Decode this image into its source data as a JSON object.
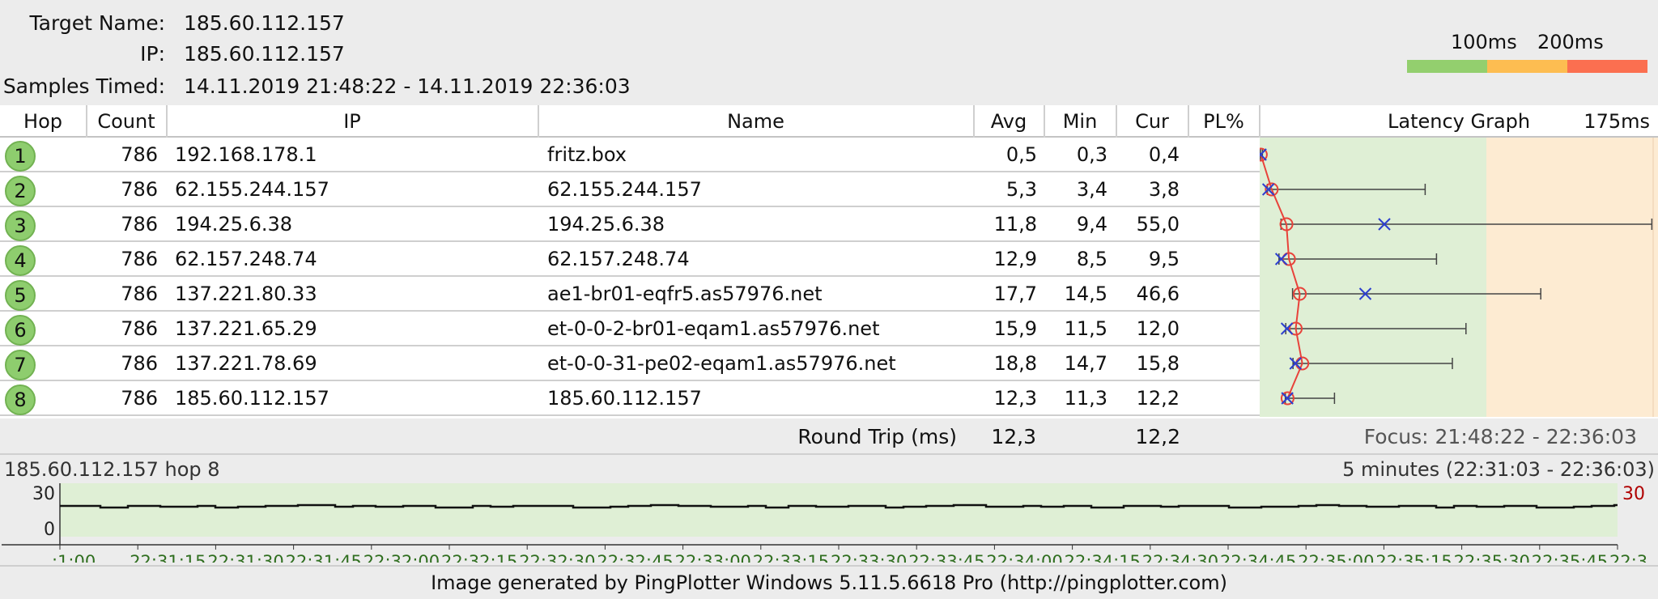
{
  "header": {
    "target_name_label": "Target Name:",
    "target_name_value": "185.60.112.157",
    "ip_label": "IP:",
    "ip_value": "185.60.112.157",
    "samples_label": "Samples Timed:",
    "samples_value": "14.11.2019 21:48:22 - 14.11.2019 22:36:03"
  },
  "legend": {
    "label_100": "100ms",
    "label_200": "200ms",
    "colors": [
      "#93cf6e",
      "#fdbd51",
      "#fb6f50"
    ]
  },
  "table": {
    "columns": [
      "Hop",
      "Count",
      "IP",
      "Name",
      "Avg",
      "Min",
      "Cur",
      "PL%",
      "Latency Graph",
      "175ms"
    ],
    "rows": [
      {
        "hop": "1",
        "count": "786",
        "ip": "192.168.178.1",
        "name": "fritz.box",
        "avg": "0,5",
        "min": "0,3",
        "cur": "0,4",
        "pl": "",
        "max_ms": 1.2
      },
      {
        "hop": "2",
        "count": "786",
        "ip": "62.155.244.157",
        "name": "62.155.244.157",
        "avg": "5,3",
        "min": "3,4",
        "cur": "3,8",
        "pl": "",
        "max_ms": 73.0
      },
      {
        "hop": "3",
        "count": "786",
        "ip": "194.25.6.38",
        "name": "194.25.6.38",
        "avg": "11,8",
        "min": "9,4",
        "cur": "55,0",
        "pl": "",
        "max_ms": 173.0
      },
      {
        "hop": "4",
        "count": "786",
        "ip": "62.157.248.74",
        "name": "62.157.248.74",
        "avg": "12,9",
        "min": "8,5",
        "cur": "9,5",
        "pl": "",
        "max_ms": 78.0
      },
      {
        "hop": "5",
        "count": "786",
        "ip": "137.221.80.33",
        "name": "ae1-br01-eqfr5.as57976.net",
        "avg": "17,7",
        "min": "14,5",
        "cur": "46,6",
        "pl": "",
        "max_ms": 124.0
      },
      {
        "hop": "6",
        "count": "786",
        "ip": "137.221.65.29",
        "name": "et-0-0-2-br01-eqam1.as57976.net",
        "avg": "15,9",
        "min": "11,5",
        "cur": "12,0",
        "pl": "",
        "max_ms": 91.0
      },
      {
        "hop": "7",
        "count": "786",
        "ip": "137.221.78.69",
        "name": "et-0-0-31-pe02-eqam1.as57976.net",
        "avg": "18,8",
        "min": "14,7",
        "cur": "15,8",
        "pl": "",
        "max_ms": 85.0
      },
      {
        "hop": "8",
        "count": "786",
        "ip": "185.60.112.157",
        "name": "185.60.112.157",
        "avg": "12,3",
        "min": "11,3",
        "cur": "12,2",
        "pl": "",
        "max_ms": 33.0
      }
    ],
    "graph_scale_ms": 175,
    "zone_thresholds_ms": [
      100,
      200
    ],
    "zone_colors": [
      "#dfefd5",
      "#fdebd2"
    ]
  },
  "round_trip": {
    "label": "Round Trip (ms)",
    "avg": "12,3",
    "cur": "12,2",
    "focus": "Focus: 21:48:22 - 22:36:03"
  },
  "timeline": {
    "title": "185.60.112.157 hop 8",
    "range": "5 minutes (22:31:03 - 22:36:03)",
    "y_top": "30",
    "y_bottom": "0",
    "right_scale": "30",
    "ticks": [
      ":1:00",
      "22:31:15",
      "22:31:30",
      "22:31:45",
      "22:32:00",
      "22:32:15",
      "22:32:30",
      "22:32:45",
      "22:33:00",
      "22:33:15",
      "22:33:30",
      "22:33:45",
      "22:34:00",
      "22:34:15",
      "22:34:30",
      "22:34:45",
      "22:35:00",
      "22:35:15",
      "22:35:30",
      "22:35:45",
      "22:3"
    ]
  },
  "footer": {
    "text": "Image generated by PingPlotter Windows 5.11.5.6618 Pro (http://pingplotter.com)"
  }
}
